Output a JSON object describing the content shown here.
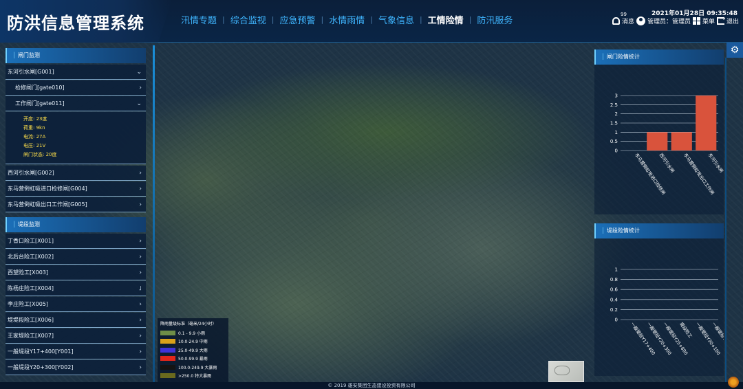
{
  "app": {
    "title": "防洪信息管理系统",
    "datetime": "2021年01月28日 09:35:48",
    "nav": [
      {
        "label": "汛情专题"
      },
      {
        "label": "综合监视"
      },
      {
        "label": "应急预警"
      },
      {
        "label": "水情雨情"
      },
      {
        "label": "气象信息"
      },
      {
        "label": "工情险情",
        "active": true
      },
      {
        "label": "防汛服务"
      }
    ],
    "messages_badge": "99",
    "messages_label": "消息",
    "user_label": "管理员：管理员",
    "menu_label": "菜单",
    "logout_label": "退出"
  },
  "gate_monitor": {
    "title": "闸门监测",
    "group1": "东河引水闸[G001]",
    "sub1": "检修闸门[gate010]",
    "sub2": "工作闸门[gate011]",
    "details": {
      "opening": "开度: 23度",
      "load": "荷重: 9kn",
      "current": "电流: 27A",
      "voltage": "电压: 21V",
      "status": "闸门状态: 20度"
    },
    "group2": "西河引水闸[G002]",
    "group3": "东马营倒虹吸进口检修闸[G004]",
    "group4": "东马营倒虹吸出口工作闸[G005]"
  },
  "levee_monitor": {
    "title": "堤段监测",
    "items": [
      "丁香口险工[X001]",
      "北后台险工[X002]",
      "西望险工[X003]",
      "陈杨庄险工[X004]",
      "李庄险工[X005]",
      "堤堤段险工[X006]",
      "王家堤险工[X007]",
      "一般堤段Y17+400[Y001]",
      "一般堤段Y20+300[Y002]"
    ]
  },
  "legend": {
    "title": "降雨量级标准（毫米/24小时）",
    "items": [
      {
        "label": "0.1 - 9.9 小雨",
        "color": "#6f8f47"
      },
      {
        "label": "10.0-24.9 中雨",
        "color": "#d9a21a"
      },
      {
        "label": "25.0-49.9 大雨",
        "color": "#3e33d8"
      },
      {
        "label": "50.0-99.9 暴雨",
        "color": "#e0261a"
      },
      {
        "label": "100.0-249.9 大暴雨",
        "color": "#141414"
      },
      {
        "label": ">250.0 特大暴雨",
        "color": "#6a6a1e"
      }
    ]
  },
  "gate_stats": {
    "title": "闸门险情统计"
  },
  "levee_stats": {
    "title": "堤段险情统计"
  },
  "footer": "© 2019 雄安集团生态建设投资有限公司",
  "colors": {
    "bar": "#d9533c",
    "accent": "#3fb6ff"
  },
  "chart_data": [
    {
      "type": "bar",
      "categories": [
        "东马营倒虹吸进口检修闸",
        "西河引水闸",
        "东马营倒虹吸出口工作闸",
        "东河引水闸"
      ],
      "values": [
        0,
        1,
        1,
        3
      ],
      "ylim": [
        0,
        3
      ],
      "yticks": [
        0,
        0.5,
        1,
        1.5,
        2,
        2.5,
        3
      ]
    },
    {
      "type": "bar",
      "categories": [
        "一般堤段Y17+400",
        "一般堤段Y20+300",
        "一般堤段Y25+800",
        "堤段险工",
        "一般堤段Y30+100",
        "一般堤段Y32+"
      ],
      "values": [
        0,
        0,
        0,
        0,
        0,
        0
      ],
      "ylim": [
        0,
        1
      ],
      "yticks": [
        0,
        0.2,
        0.4,
        0.6,
        0.8,
        1
      ]
    }
  ]
}
